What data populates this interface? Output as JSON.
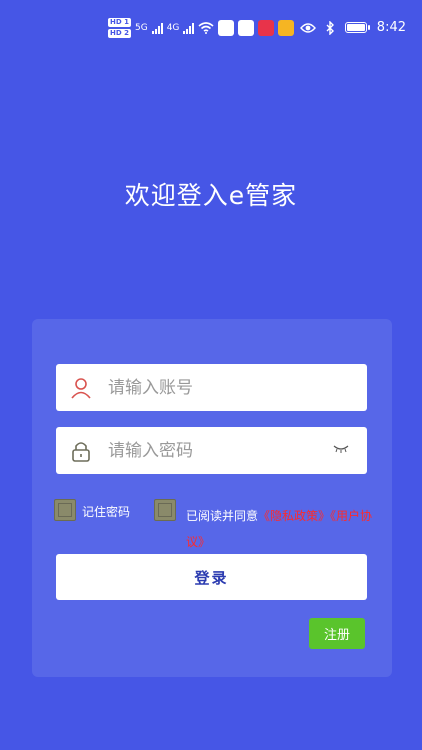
{
  "status_bar": {
    "hd1": "HD 1",
    "hd2": "HD 2",
    "net1": "5G",
    "net2": "4G",
    "time": "8:42"
  },
  "title": "欢迎登入e管家",
  "account_input": {
    "placeholder": "请输入账号",
    "value": ""
  },
  "password_input": {
    "placeholder": "请输入密码",
    "value": ""
  },
  "remember": {
    "label": "记住密码"
  },
  "agreement": {
    "prefix": "已阅读并同意",
    "privacy_link": "《隐私政策》",
    "user_link": "《用户协议》"
  },
  "login_button": "登录",
  "register_button": "注册",
  "colors": {
    "background": "#4656e6",
    "card": "#5767e8",
    "link": "#ff2a2a",
    "register": "#5ac42c"
  }
}
